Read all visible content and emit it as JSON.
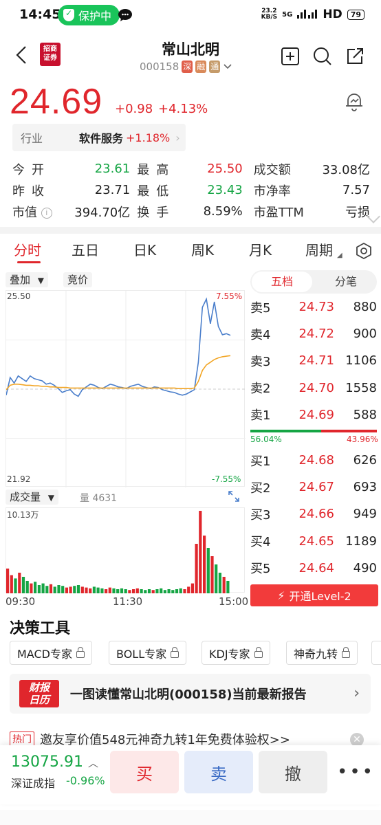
{
  "status_bar": {
    "time": "14:45",
    "protect_label": "保护中",
    "net_speed_top": "23.2",
    "net_speed_unit": "KB/S",
    "network": "5G",
    "hd": "HD",
    "battery": "79"
  },
  "header": {
    "broker_logo_line1": "招商",
    "broker_logo_line2": "证券",
    "stock_name": "常山北明",
    "stock_code": "000158",
    "tags": [
      "深",
      "融",
      "通"
    ]
  },
  "quote": {
    "price": "24.69",
    "change": "+0.98",
    "change_pct": "+4.13%",
    "industry_label": "行业",
    "industry_name": "软件服务",
    "industry_pct": "+1.18%"
  },
  "stats": {
    "rows": [
      {
        "l1": "今开",
        "v1": "23.61",
        "c1": "green",
        "l2": "最高",
        "v2": "25.50",
        "c2": "red",
        "l3": "成交额",
        "v3": "33.08亿"
      },
      {
        "l1": "昨收",
        "v1": "23.71",
        "c1": "plain",
        "l2": "最低",
        "v2": "23.43",
        "c2": "green",
        "l3": "市净率",
        "v3": "7.57"
      },
      {
        "l1": "市值",
        "v1": "394.70亿",
        "c1": "plain",
        "l2": "换手",
        "v2": "8.59%",
        "c2": "plain",
        "l3": "市盈TTM",
        "v3": "亏损"
      }
    ]
  },
  "tabs": [
    "分时",
    "五日",
    "日K",
    "周K",
    "月K",
    "周期"
  ],
  "chart_controls": {
    "overlay_label": "叠加",
    "auction_label": "竞价",
    "volume_label": "成交量",
    "volume_value": "量 4631",
    "vol_max": "10.13万"
  },
  "chart_data": {
    "type": "line",
    "title": "",
    "ylim": [
      21.92,
      25.5
    ],
    "pct_top": "7.55%",
    "pct_bottom": "-7.55%",
    "y_top_label": "25.50",
    "y_bottom_label": "21.92",
    "x_ticks": [
      "09:30",
      "11:30",
      "15:00"
    ],
    "prev_close": 23.71,
    "series": [
      {
        "name": "price",
        "values": [
          23.6,
          23.92,
          23.82,
          23.95,
          23.9,
          23.85,
          23.95,
          23.9,
          23.88,
          23.86,
          23.8,
          23.82,
          23.78,
          23.72,
          23.65,
          23.68,
          23.7,
          23.62,
          23.58,
          23.7,
          23.75,
          23.8,
          23.78,
          23.74,
          23.72,
          23.76,
          23.8,
          23.78,
          23.75,
          23.74,
          23.72,
          23.76,
          23.78,
          23.8,
          23.76,
          23.74,
          23.72,
          23.75,
          23.74,
          23.7,
          23.68,
          23.66,
          23.65,
          23.62,
          23.6,
          23.62,
          23.66,
          23.7,
          24.2,
          25.2,
          25.35,
          24.9,
          25.3,
          24.85,
          24.7,
          24.72,
          24.69
        ]
      },
      {
        "name": "avg",
        "values": [
          23.7,
          23.78,
          23.8,
          23.8,
          23.79,
          23.78,
          23.78,
          23.77,
          23.77,
          23.76,
          23.76,
          23.75,
          23.75,
          23.74,
          23.74,
          23.74,
          23.73,
          23.73,
          23.73,
          23.73,
          23.73,
          23.73,
          23.73,
          23.73,
          23.73,
          23.73,
          23.73,
          23.73,
          23.73,
          23.73,
          23.73,
          23.73,
          23.73,
          23.73,
          23.73,
          23.73,
          23.73,
          23.73,
          23.73,
          23.73,
          23.73,
          23.73,
          23.73,
          23.72,
          23.72,
          23.72,
          23.72,
          23.73,
          23.85,
          24.05,
          24.15,
          24.2,
          24.25,
          24.28,
          24.3,
          24.31,
          24.32
        ]
      }
    ],
    "volume": [
      30,
      22,
      18,
      25,
      20,
      15,
      12,
      14,
      10,
      12,
      9,
      11,
      8,
      10,
      9,
      7,
      8,
      9,
      10,
      8,
      7,
      6,
      8,
      7,
      6,
      5,
      7,
      6,
      5,
      6,
      5,
      4,
      5,
      6,
      5,
      4,
      5,
      4,
      5,
      6,
      4,
      5,
      4,
      5,
      6,
      5,
      8,
      12,
      60,
      100,
      70,
      55,
      45,
      35,
      25,
      20,
      15
    ]
  },
  "order_book": {
    "seg_active": "五档",
    "seg_other": "分笔",
    "asks": [
      {
        "label": "卖5",
        "price": "24.73",
        "vol": "880"
      },
      {
        "label": "卖4",
        "price": "24.72",
        "vol": "900"
      },
      {
        "label": "卖3",
        "price": "24.71",
        "vol": "1106"
      },
      {
        "label": "卖2",
        "price": "24.70",
        "vol": "1558"
      },
      {
        "label": "卖1",
        "price": "24.69",
        "vol": "588"
      }
    ],
    "buy_ratio": "56.04%",
    "sell_ratio": "43.96%",
    "buy_ratio_value": 0.5604,
    "bids": [
      {
        "label": "买1",
        "price": "24.68",
        "vol": "626"
      },
      {
        "label": "买2",
        "price": "24.67",
        "vol": "693"
      },
      {
        "label": "买3",
        "price": "24.66",
        "vol": "949"
      },
      {
        "label": "买4",
        "price": "24.65",
        "vol": "1189"
      },
      {
        "label": "买5",
        "price": "24.64",
        "vol": "490"
      }
    ],
    "level2_label": "开通Level-2"
  },
  "tools": {
    "title": "决策工具",
    "chips": [
      "MACD专家",
      "BOLL专家",
      "KDJ专家",
      "神奇九转"
    ]
  },
  "report": {
    "logo_line1": "财报",
    "logo_line2": "日历",
    "text": "一图读懂常山北明(000158)当前最新报告"
  },
  "hot": {
    "tag": "热门",
    "text": "邀友享价值548元神奇九转1年免费体验权>>"
  },
  "bottom": {
    "index_value": "13075.91",
    "index_name": "深证成指",
    "index_pct": "-0.96%",
    "buy": "买",
    "sell": "卖",
    "cancel": "撤",
    "more": "•••"
  },
  "colors": {
    "up": "#e0262c",
    "down": "#15a544",
    "avg_line": "#f2a524",
    "price_line": "#4a7ecb"
  }
}
